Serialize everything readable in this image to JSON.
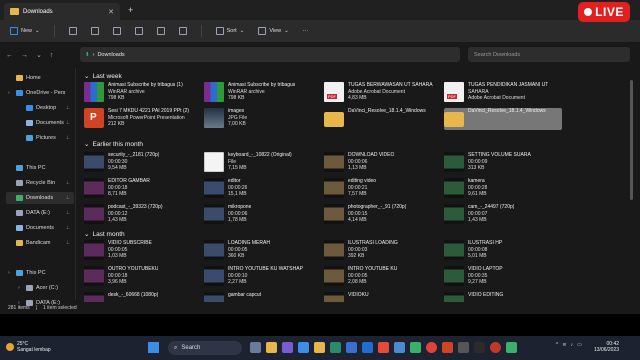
{
  "window": {
    "tab_title": "Downloads",
    "live_label": "LIVE"
  },
  "commands": {
    "new": "New",
    "sort": "Sort",
    "view": "View"
  },
  "address": {
    "path": "Downloads",
    "search_placeholder": "Search Downloads"
  },
  "sidebar": {
    "items": [
      {
        "label": "Home",
        "icon": "home-icon",
        "color": "#e8b64a"
      },
      {
        "label": "OneDrive - Pers",
        "icon": "cloud-icon",
        "color": "#3a8ee6"
      },
      {
        "label": "Desktop",
        "icon": "desktop-icon",
        "color": "#3a8ee6"
      },
      {
        "label": "Documents",
        "icon": "documents-icon",
        "color": "#8ab4e8"
      },
      {
        "label": "Pictures",
        "icon": "pictures-icon",
        "color": "#4aa3df"
      },
      {
        "label": "This PC",
        "icon": "pc-icon",
        "color": "#4aa3df"
      },
      {
        "label": "Recycle Bin",
        "icon": "recycle-bin-icon",
        "color": "#9aa3b8"
      },
      {
        "label": "Downloads",
        "icon": "download-icon",
        "color": "#3ab06a"
      },
      {
        "label": "DATA (E:)",
        "icon": "drive-icon",
        "color": "#9aa3b8"
      },
      {
        "label": "Documents",
        "icon": "documents-icon",
        "color": "#8ab4e8"
      },
      {
        "label": "Bandicam",
        "icon": "folder-icon",
        "color": "#e8b64a"
      },
      {
        "label": "This PC",
        "icon": "pc-icon",
        "color": "#4aa3df"
      },
      {
        "label": "Acer (C:)",
        "icon": "drive-icon",
        "color": "#9aa3b8"
      },
      {
        "label": "DATA (E:)",
        "icon": "drive-icon",
        "color": "#9aa3b8"
      }
    ]
  },
  "groups": {
    "last_week": "Last week",
    "earlier_month": "Earlier this month",
    "last_month": "Last month"
  },
  "files": [
    {
      "name": "Animasi Subscribe by tribagus (1)",
      "type": "WinRAR archive",
      "size": "798 KB",
      "thumb": "rar"
    },
    {
      "name": "Animasi Subscribe by tribagus",
      "type": "WinRAR archive",
      "size": "798 KB",
      "thumb": "rar"
    },
    {
      "name": "TUGAS BERWAWASAN UT SAHARA",
      "type": "Adobe Acrobat Document",
      "size": "4,83 MB",
      "thumb": "pdf"
    },
    {
      "name": "TUGAS PENDIDIKAN JASMANI UT",
      "type": "SAHARA",
      "size": "Adobe Acrobat Document",
      "thumb": "pdf"
    },
    {
      "name": "Sesi 7 MKDU 4221 PAI 2019 PPt (2)",
      "type": "Microsoft PowerPoint Presentation",
      "size": "212 KB",
      "thumb": "ppt"
    },
    {
      "name": "images",
      "type": "JPG File",
      "size": "7,00 KB",
      "thumb": "img"
    },
    {
      "name": "DaVinci_Resolve_18.1.4_Windows",
      "type": "",
      "size": "",
      "thumb": "folder"
    },
    {
      "name": "DaVinci_Resolve_18.1.4_Windows",
      "type": "",
      "size": "",
      "thumb": "folder"
    },
    {
      "name": "security_-_2181 (720p)",
      "type": "00:00:30",
      "size": "9,54 MB",
      "thumb": "vid"
    },
    {
      "name": "keyboard_-_10822 (Original)",
      "type": "File",
      "size": "7,15 MB",
      "thumb": "doc"
    },
    {
      "name": "DOWNLOAD VIDEO",
      "type": "00:00:06",
      "size": "1,13 MB",
      "thumb": "vid2"
    },
    {
      "name": "SETTING VOLUME SUARA",
      "type": "00:00:09",
      "size": "313 KB",
      "thumb": "vid3"
    },
    {
      "name": "EDITOR GAMBAR",
      "type": "00:00:18",
      "size": "8,71 MB",
      "thumb": "vid4"
    },
    {
      "name": "editor",
      "type": "00:00:26",
      "size": "15,1 MB",
      "thumb": "vid"
    },
    {
      "name": "editing video",
      "type": "00:00:21",
      "size": "7,57 MB",
      "thumb": "vid2"
    },
    {
      "name": "kamera",
      "type": "00:00:28",
      "size": "9,61 MB",
      "thumb": "vid3"
    },
    {
      "name": "podcast_-_39323 (720p)",
      "type": "00:00:12",
      "size": "1,43 MB",
      "thumb": "vid4"
    },
    {
      "name": "mikropone",
      "type": "00:00:06",
      "size": "1,78 MB",
      "thumb": "vid"
    },
    {
      "name": "photographer_-_91 (720p)",
      "type": "00:00:15",
      "size": "4,14 MB",
      "thumb": "vid2"
    },
    {
      "name": "cam_-_24497 (720p)",
      "type": "00:00:07",
      "size": "1,43 MB",
      "thumb": "vid3"
    },
    {
      "name": "VIDIO SUBSCRIBE",
      "type": "00:00:05",
      "size": "1,03 MB",
      "thumb": "vid4"
    },
    {
      "name": "LOADING MERAH",
      "type": "00:00:05",
      "size": "360 KB",
      "thumb": "vid"
    },
    {
      "name": "ILUSTRASI LOADING",
      "type": "00:00:03",
      "size": "392 KB",
      "thumb": "vid2"
    },
    {
      "name": "ILUSTRASI HP",
      "type": "00:00:08",
      "size": "5,01 MB",
      "thumb": "vid3"
    },
    {
      "name": "OUTRO YOUTUBEKU",
      "type": "00:00:18",
      "size": "3,96 MB",
      "thumb": "vid4"
    },
    {
      "name": "INTRO YOUTUBE KU WATSHAP",
      "type": "00:00:10",
      "size": "2,27 MB",
      "thumb": "vid"
    },
    {
      "name": "INTRO YOUTUBE KU",
      "type": "00:00:05",
      "size": "2,08 MB",
      "thumb": "vid2"
    },
    {
      "name": "VIDIO LAPTOP",
      "type": "00:00:35",
      "size": "9,27 MB",
      "thumb": "vid3"
    },
    {
      "name": "desk_-_60668 (1080p)",
      "type": "",
      "size": "",
      "thumb": "vid4"
    },
    {
      "name": "gambar capcut",
      "type": "",
      "size": "",
      "thumb": "vid"
    },
    {
      "name": "VIDIOKU",
      "type": "",
      "size": "",
      "thumb": "vid2"
    },
    {
      "name": "VIDIO EDITING",
      "type": "",
      "size": "",
      "thumb": "vid3"
    }
  ],
  "status": {
    "count": "281 items",
    "selected": "1 item selected"
  },
  "taskbar": {
    "temp": "25°C",
    "weather": "Sangat lembap",
    "search": "Search",
    "time": "00:42",
    "date": "13/06/2023"
  }
}
